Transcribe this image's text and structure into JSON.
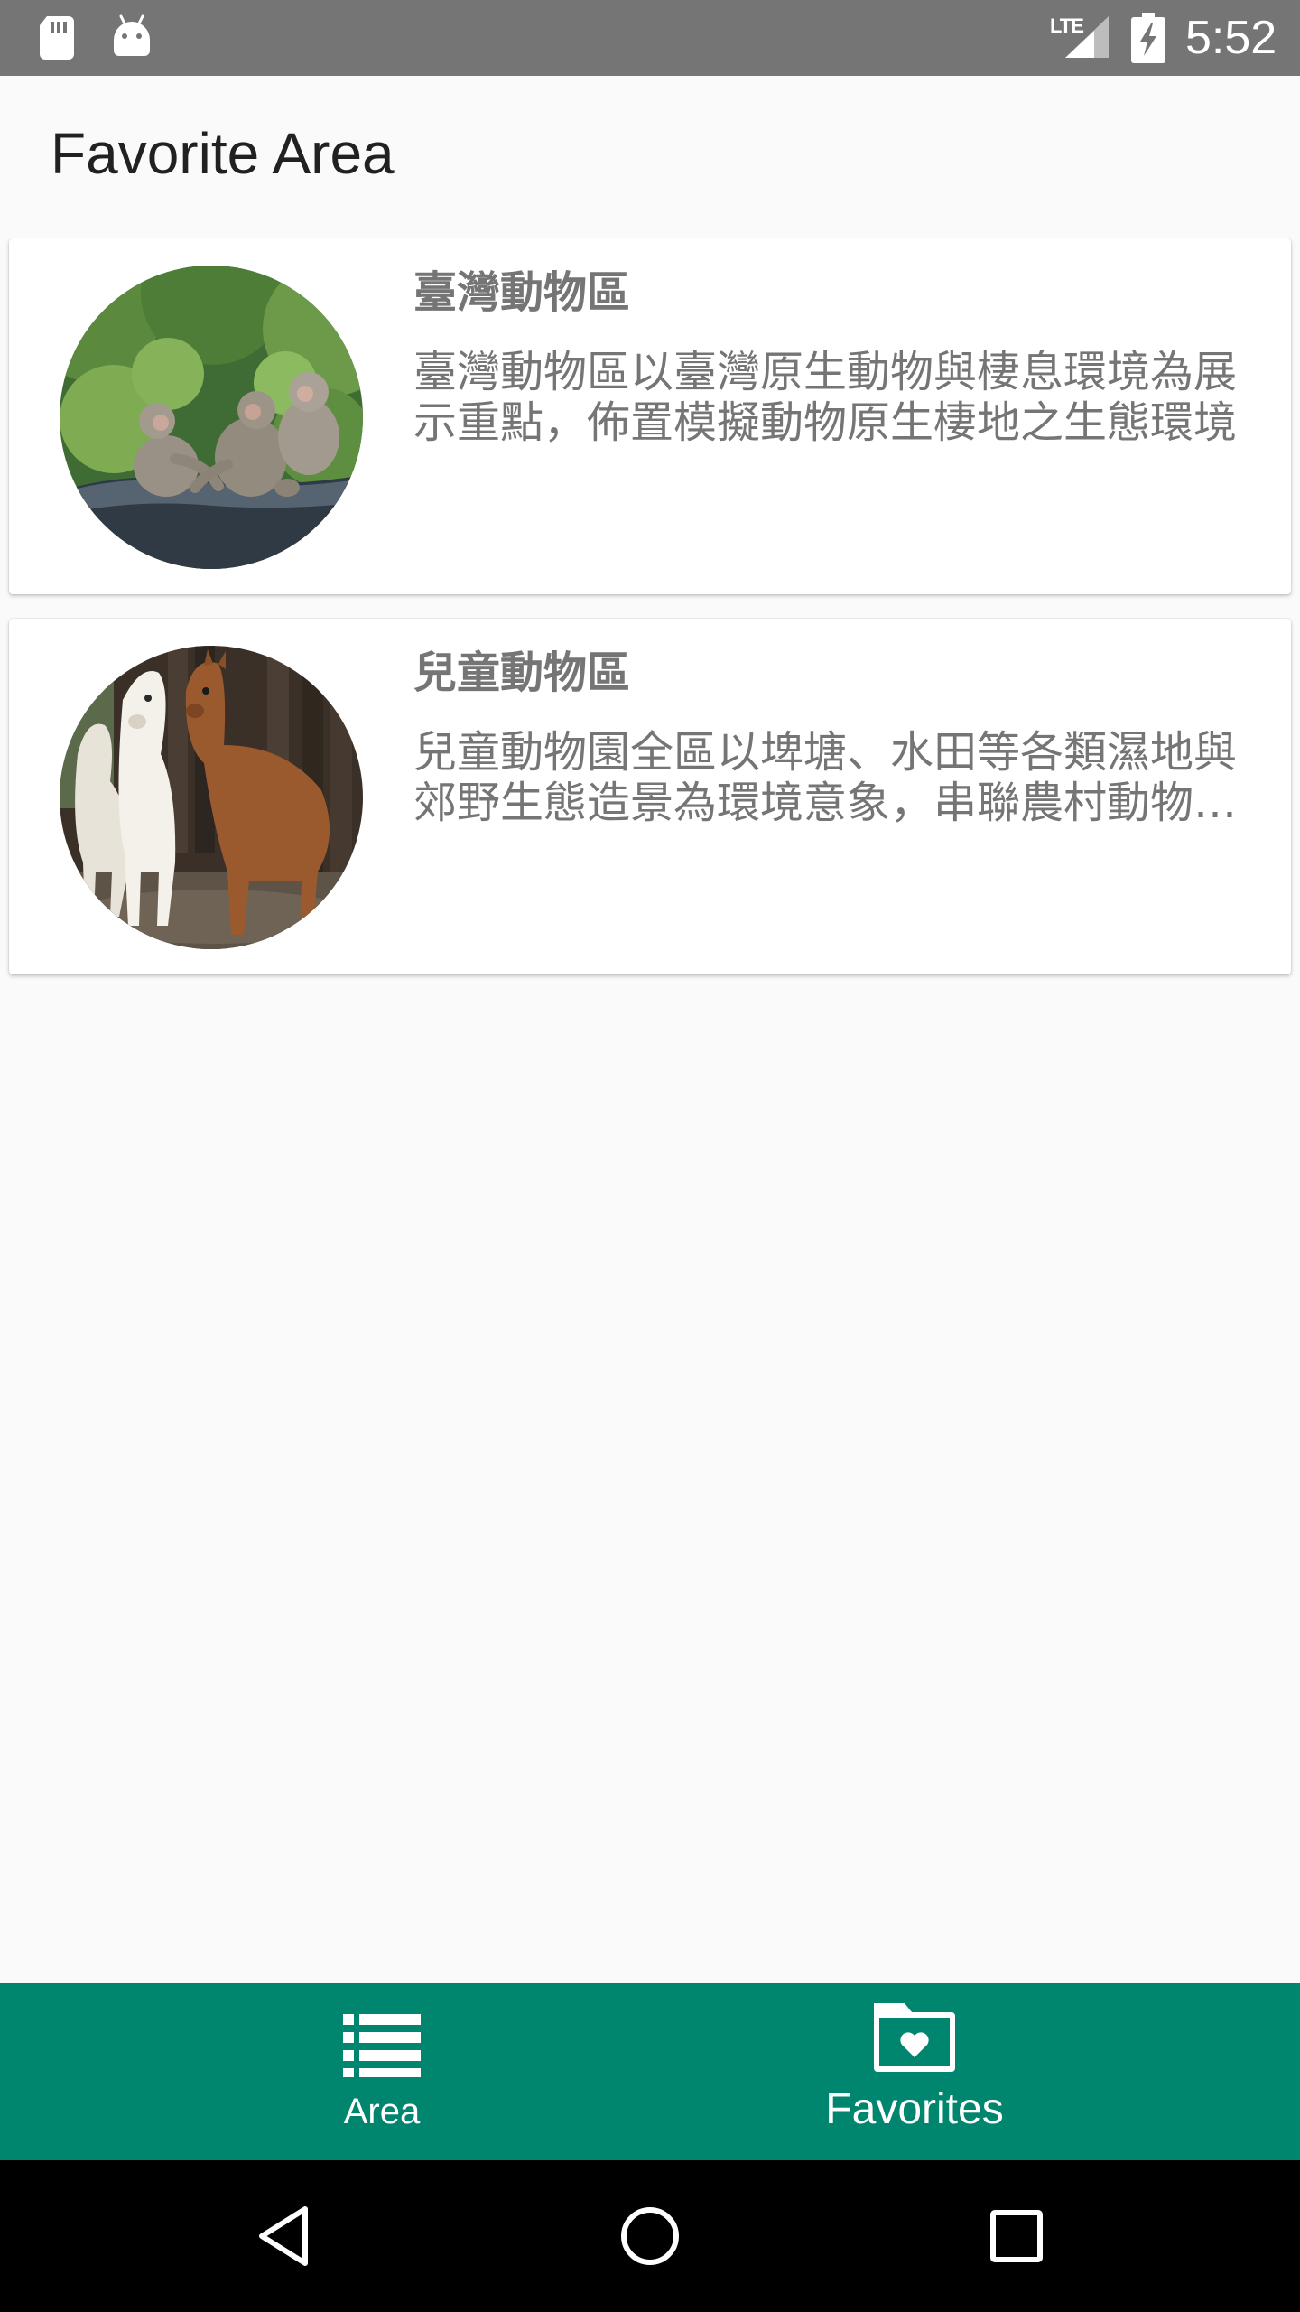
{
  "status_bar": {
    "network": "LTE",
    "time": "5:52"
  },
  "app_bar": {
    "title": "Favorite Area"
  },
  "favorites": [
    {
      "name": "臺灣動物區",
      "description": "臺灣動物區以臺灣原生動物與棲息環境為展示重點，佈置模擬動物原生棲地之生態環境",
      "photo": "macaques-on-log"
    },
    {
      "name": "兒童動物區",
      "description": "兒童動物園全區以埤塘、水田等各類濕地與郊野生態造景為環境意象，串聯農村動物與自然生態",
      "photo": "alpacas"
    }
  ],
  "bottom_nav": {
    "accent_color": "#00856f",
    "items": [
      {
        "label": "Area",
        "icon": "list-icon",
        "selected": false
      },
      {
        "label": "Favorites",
        "icon": "heart-folder-icon",
        "selected": true
      }
    ]
  },
  "system_nav": {
    "back_icon": "back-triangle-icon",
    "home_icon": "home-circle-icon",
    "recents_icon": "recents-square-icon"
  }
}
